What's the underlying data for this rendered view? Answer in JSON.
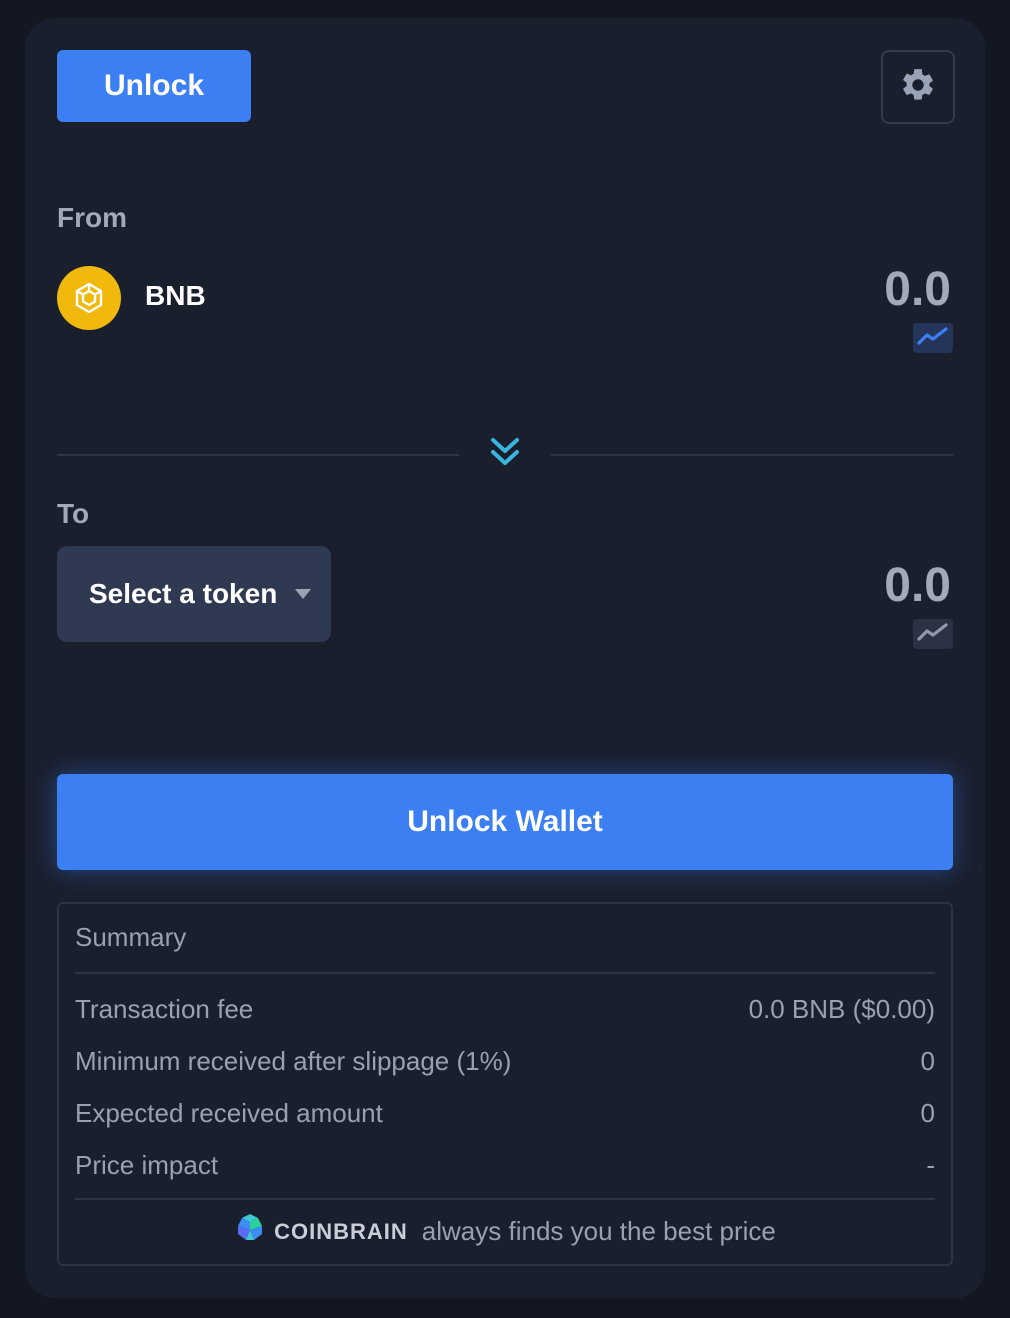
{
  "header": {
    "unlock_label": "Unlock",
    "settings_icon": "gear-icon"
  },
  "from": {
    "label": "From",
    "token_name": "BNB",
    "token_icon": "bnb-logo-icon",
    "amount": "0.0",
    "chart_icon": "chart-line-icon"
  },
  "switch_icon": "chevron-double-down-icon",
  "to": {
    "label": "To",
    "select_label": "Select a token",
    "amount": "0.0",
    "chart_icon": "chart-line-icon"
  },
  "cta": {
    "label": "Unlock Wallet"
  },
  "summary": {
    "title": "Summary",
    "rows": [
      {
        "label": "Transaction fee",
        "value": "0.0 BNB ($0.00)"
      },
      {
        "label": "Minimum received after slippage (1%)",
        "value": "0"
      },
      {
        "label": "Expected received amount",
        "value": "0"
      },
      {
        "label": "Price impact",
        "value": "-"
      }
    ],
    "footer_brand": "COINBRAIN",
    "footer_text": "always finds you the best price"
  },
  "colors": {
    "accent": "#3c7ff3",
    "background": "#1a1f2e",
    "bnb": "#f0b90b",
    "switch_arrow": "#39b5e0"
  }
}
